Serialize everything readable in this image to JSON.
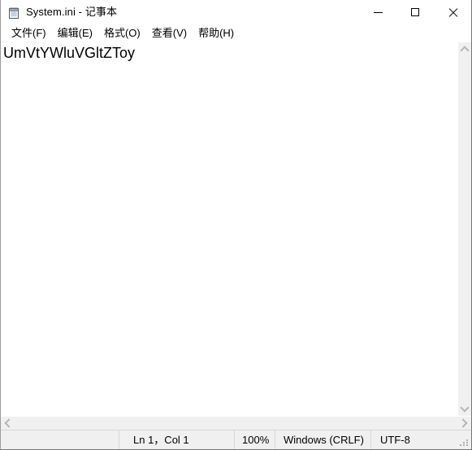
{
  "window": {
    "icon_name": "notepad-icon",
    "title": "System.ini - 记事本",
    "controls": {
      "minimize_label": "最小化",
      "maximize_label": "最大化",
      "close_label": "关闭"
    }
  },
  "menubar": {
    "items": [
      {
        "label": "文件(F)",
        "name": "menu-file"
      },
      {
        "label": "编辑(E)",
        "name": "menu-edit"
      },
      {
        "label": "格式(O)",
        "name": "menu-format"
      },
      {
        "label": "查看(V)",
        "name": "menu-view"
      },
      {
        "label": "帮助(H)",
        "name": "menu-help"
      }
    ]
  },
  "editor": {
    "content": "UmVtYWluVGltZToy"
  },
  "scrollbars": {
    "vertical": {
      "up_icon": "chevron-up-icon",
      "down_icon": "chevron-down-icon"
    },
    "horizontal": {
      "left_icon": "chevron-left-icon",
      "right_icon": "chevron-right-icon"
    }
  },
  "statusbar": {
    "line_col": "Ln 1，Col 1",
    "zoom": "100%",
    "line_ending": "Windows (CRLF)",
    "encoding": "UTF-8"
  },
  "colors": {
    "window_bg": "#ffffff",
    "chrome_bg": "#f0f0f0",
    "border": "#767676",
    "separator": "#d7d7d7",
    "scroll_arrow": "#b4b4b4",
    "close_hover": "#e81123",
    "text": "#000000"
  }
}
